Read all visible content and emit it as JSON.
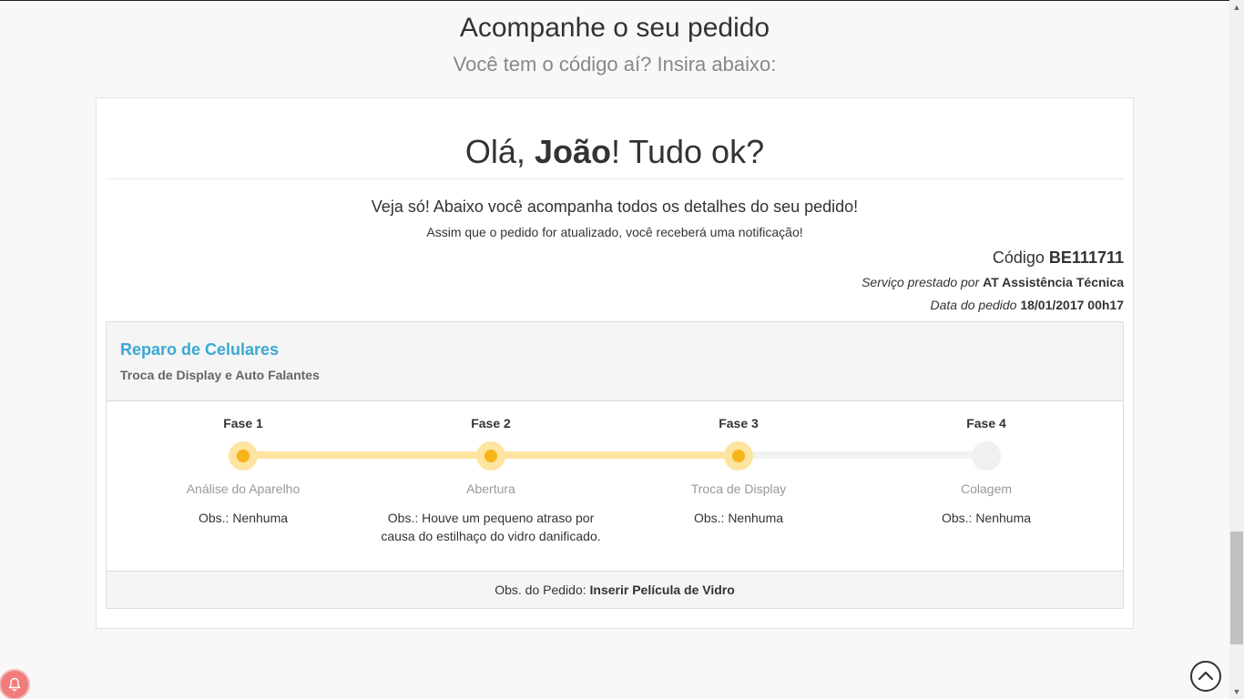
{
  "header": {
    "title": "Acompanhe o seu pedido",
    "subtitle": "Você tem o código aí? Insira abaixo:"
  },
  "greeting": {
    "prefix": "Olá, ",
    "name": "João",
    "suffix": "! Tudo ok?"
  },
  "intro": {
    "line1": "Veja só! Abaixo você acompanha todos os detalhes do seu pedido!",
    "line2": "Assim que o pedido for atualizado, você receberá uma notificação!"
  },
  "order": {
    "code_label": "Código ",
    "code": "BE111711",
    "service_label": "Serviço prestado por ",
    "provider": "AT Assistência Técnica",
    "date_label": "Data do pedido ",
    "date": "18/01/2017 00h17"
  },
  "service": {
    "title": "Reparo de Celulares",
    "subtitle": "Troca de Display e Auto Falantes",
    "phases": [
      {
        "label": "Fase 1",
        "name": "Análise do Aparelho",
        "obs": "Obs.: Nenhuma",
        "done": true
      },
      {
        "label": "Fase 2",
        "name": "Abertura",
        "obs": "Obs.: Houve um pequeno atraso por causa do estilhaço do vidro danificado.",
        "done": true
      },
      {
        "label": "Fase 3",
        "name": "Troca de Display",
        "obs": "Obs.: Nenhuma",
        "done": true
      },
      {
        "label": "Fase 4",
        "name": "Colagem",
        "obs": "Obs.: Nenhuma",
        "done": false
      }
    ],
    "footer_label": "Obs. do Pedido: ",
    "footer_value": "Inserir Película de Vidro"
  },
  "colors": {
    "accent": "#3aa9d3",
    "progress_done": "#f6b31a",
    "progress_track": "#fde4a0"
  },
  "icons": {
    "notification": "bell-icon",
    "back_to_top": "chevron-up-icon"
  }
}
